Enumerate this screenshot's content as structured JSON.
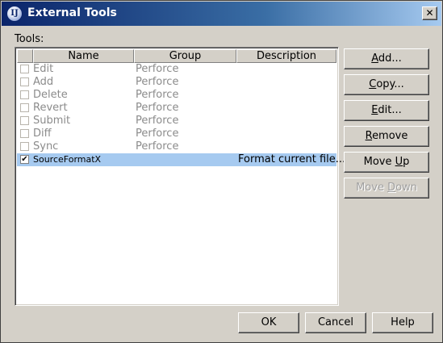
{
  "window": {
    "title": "External Tools",
    "icon": "app-logo-icon",
    "close_glyph": "✕"
  },
  "tools_label": "Tools:",
  "table": {
    "columns": [
      "",
      "Name",
      "Group",
      "Description"
    ],
    "rows": [
      {
        "checked": false,
        "enabled": false,
        "name": "Edit",
        "group": "Perforce",
        "description": ""
      },
      {
        "checked": false,
        "enabled": false,
        "name": "Add",
        "group": "Perforce",
        "description": ""
      },
      {
        "checked": false,
        "enabled": false,
        "name": "Delete",
        "group": "Perforce",
        "description": ""
      },
      {
        "checked": false,
        "enabled": false,
        "name": "Revert",
        "group": "Perforce",
        "description": ""
      },
      {
        "checked": false,
        "enabled": false,
        "name": "Submit",
        "group": "Perforce",
        "description": ""
      },
      {
        "checked": false,
        "enabled": false,
        "name": "Diff",
        "group": "Perforce",
        "description": ""
      },
      {
        "checked": false,
        "enabled": false,
        "name": "Sync",
        "group": "Perforce",
        "description": ""
      },
      {
        "checked": true,
        "enabled": true,
        "selected": true,
        "name": "SourceFormatX",
        "group": "",
        "description": "Format current file..."
      }
    ]
  },
  "side_buttons": {
    "add": {
      "pre": "",
      "mnemonic": "A",
      "post": "dd..."
    },
    "copy": {
      "pre": "",
      "mnemonic": "C",
      "post": "opy..."
    },
    "edit": {
      "pre": "",
      "mnemonic": "E",
      "post": "dit..."
    },
    "remove": {
      "pre": "",
      "mnemonic": "R",
      "post": "emove"
    },
    "move_up": {
      "pre": "Move ",
      "mnemonic": "U",
      "post": "p"
    },
    "move_down": {
      "pre": "Move ",
      "mnemonic": "D",
      "post": "own",
      "disabled": true
    }
  },
  "bottom_buttons": {
    "ok": "OK",
    "cancel": "Cancel",
    "help": "Help"
  },
  "colors": {
    "title_gradient_start": "#0a246a",
    "title_gradient_end": "#a6caf0",
    "selection": "#a6caf0",
    "face": "#d4d0c8"
  }
}
